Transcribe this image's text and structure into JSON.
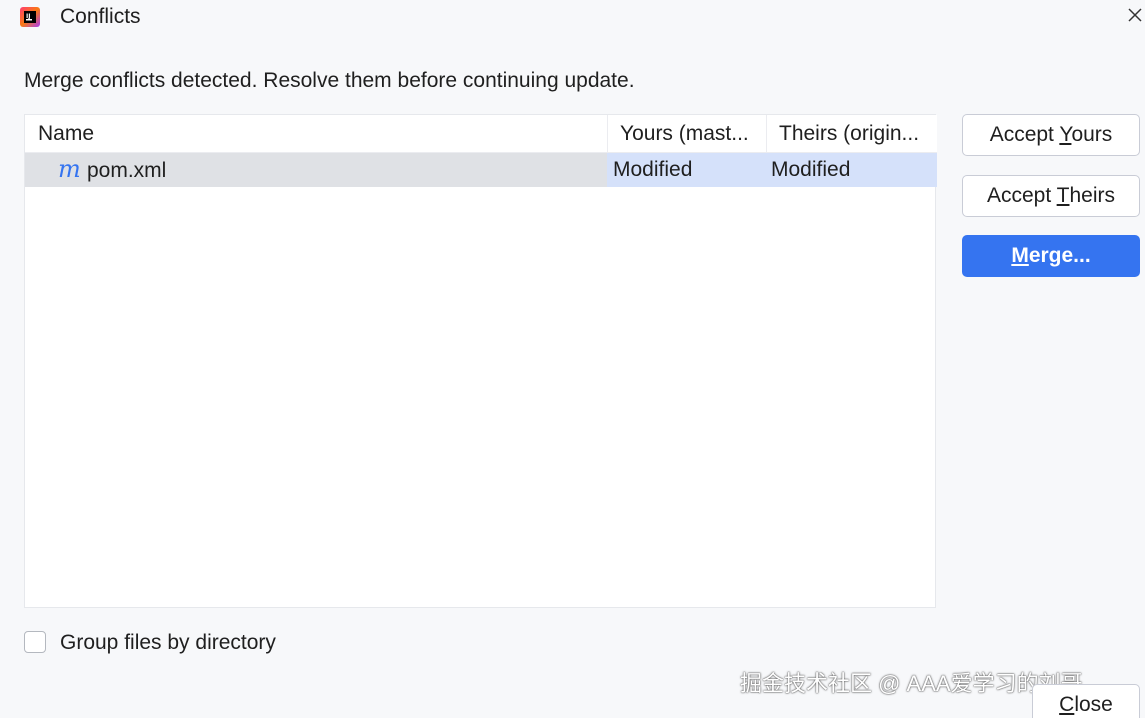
{
  "window": {
    "title": "Conflicts",
    "app_icon": "intellij-idea-icon",
    "close_icon": "close-icon"
  },
  "message": "Merge conflicts detected. Resolve them before continuing update.",
  "table": {
    "columns": [
      "Name",
      "Yours (mast...",
      "Theirs (origin..."
    ],
    "rows": [
      {
        "icon": "maven-m-icon",
        "icon_glyph": "m",
        "name": "pom.xml",
        "yours": "Modified",
        "theirs": "Modified"
      }
    ]
  },
  "buttons": {
    "accept_yours": {
      "pre": "Accept ",
      "mnemonic": "Y",
      "post": "ours"
    },
    "accept_theirs": {
      "pre": "Accept ",
      "mnemonic": "T",
      "post": "heirs"
    },
    "merge": {
      "pre": "",
      "mnemonic": "M",
      "post": "erge..."
    },
    "close": {
      "pre": "",
      "mnemonic": "C",
      "post": "lose"
    }
  },
  "options": {
    "group_by_directory_label": "Group files by directory",
    "group_by_directory_checked": false
  },
  "watermark": "掘金技术社区 @ AAA爱学习的刘哥",
  "colors": {
    "accent": "#3574f0",
    "selection": "#d5e1fa",
    "row_hover": "#dfe1e5",
    "background": "#f7f8fa"
  }
}
